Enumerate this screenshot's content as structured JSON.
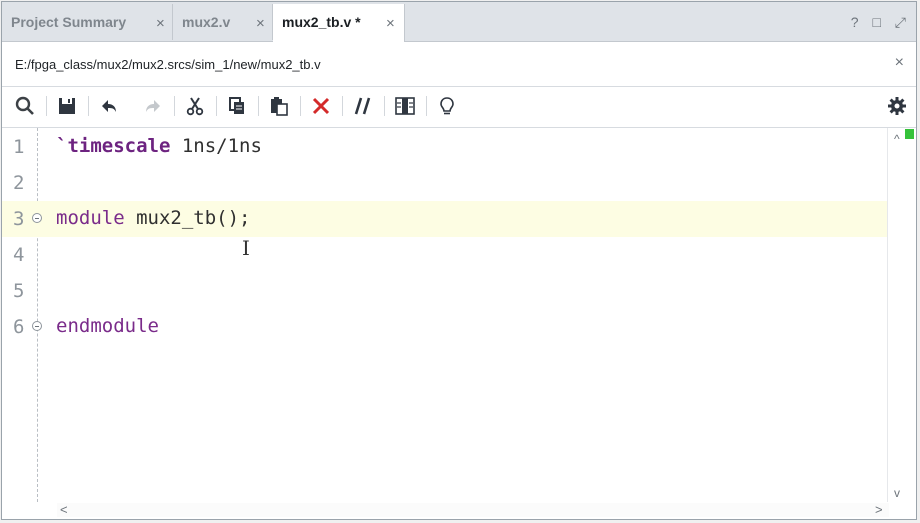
{
  "tabs": [
    {
      "label": "Project Summary",
      "close": "×"
    },
    {
      "label": "mux2.v",
      "close": "×"
    },
    {
      "label": "mux2_tb.v *",
      "close": "×"
    }
  ],
  "window_controls": {
    "help": "?",
    "restore": "□",
    "maximize": "⤢"
  },
  "path": {
    "text": "E:/fpga_class/mux2/mux2.srcs/sim_1/new/mux2_tb.v",
    "close": "×"
  },
  "toolbar": {
    "icons": [
      "search-icon",
      "save-icon",
      "undo-icon",
      "redo-icon",
      "cut-icon",
      "copy-icon",
      "paste-icon",
      "delete-icon",
      "comment-icon",
      "column-select-icon",
      "lightbulb-icon",
      "settings-icon"
    ]
  },
  "editor": {
    "lines": [
      {
        "num": "1",
        "tick": "`",
        "kw": "timescale",
        "rest": " 1ns/1ns"
      },
      {
        "num": "2"
      },
      {
        "num": "3",
        "kw": "module",
        "rest": " mux2_tb();"
      },
      {
        "num": "4"
      },
      {
        "num": "5"
      },
      {
        "num": "6",
        "kw": "endmodule",
        "rest": ""
      }
    ]
  },
  "scroll": {
    "up": "^",
    "down": "v",
    "left": "<",
    "right": ">"
  },
  "colors": {
    "keyword": "#7a2b8a",
    "current_line": "#fdfde3",
    "marker": "#35c23a"
  }
}
